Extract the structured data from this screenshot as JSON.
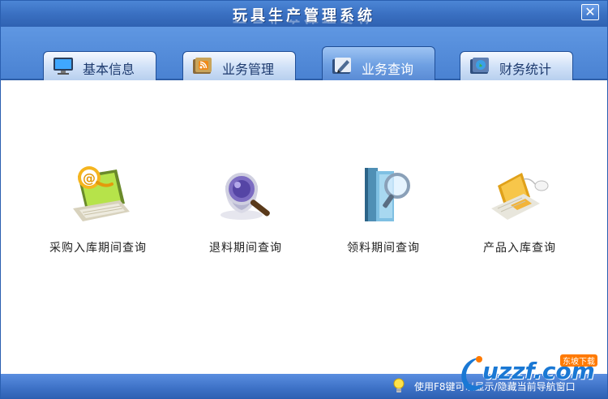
{
  "window": {
    "title": "玩具生产管理系统",
    "close_symbol": "✕"
  },
  "tabs": [
    {
      "label": "基本信息",
      "icon": "monitor-icon",
      "active": false
    },
    {
      "label": "业务管理",
      "icon": "rss-folder-icon",
      "active": false
    },
    {
      "label": "业务查询",
      "icon": "folder-pen-icon",
      "active": true
    },
    {
      "label": "财务统计",
      "icon": "globe-book-icon",
      "active": false
    }
  ],
  "tools": [
    {
      "label": "采购入库期间查询",
      "icon": "laptop-email-icon"
    },
    {
      "label": "退料期间查询",
      "icon": "magnifier-icon"
    },
    {
      "label": "领料期间查询",
      "icon": "books-magnifier-icon"
    },
    {
      "label": "产品入库查询",
      "icon": "laptop-mouse-icon"
    }
  ],
  "status": {
    "hint": "使用F8键可以显示/隐藏当前导航窗口",
    "hint_icon": "lightbulb-icon"
  },
  "watermark": {
    "text": "uzzf.com",
    "sub": "东坡下载"
  },
  "colors": {
    "titlebar": "#3a70c2",
    "tabstrip": "#5f97e2",
    "statusbar": "#3d71c6",
    "active_tab": "#6d9fe2"
  }
}
